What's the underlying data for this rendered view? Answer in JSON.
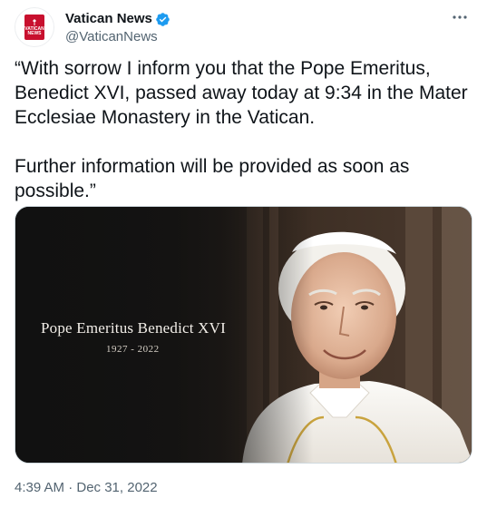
{
  "tweet": {
    "display_name": "Vatican News",
    "handle": "@VaticanNews",
    "avatar_text": [
      "VATICAN",
      "NEWS"
    ],
    "verified": true,
    "more_icon": "more-horizontal-icon",
    "text_paragraphs": [
      "“With sorrow I inform you that the Pope Emeritus, Benedict XVI, passed away today at 9:34 in the Mater Ecclesiae Monastery in the Vatican.",
      "Further information will be provided as soon as possible.”"
    ],
    "media": {
      "caption_title": "Pope Emeritus Benedict XVI",
      "caption_years": "1927 - 2022"
    },
    "timestamp": "4:39 AM · Dec 31, 2022"
  },
  "colors": {
    "brand": "#c8102e",
    "verified": "#1d9bf0",
    "secondary_text": "#536471"
  }
}
